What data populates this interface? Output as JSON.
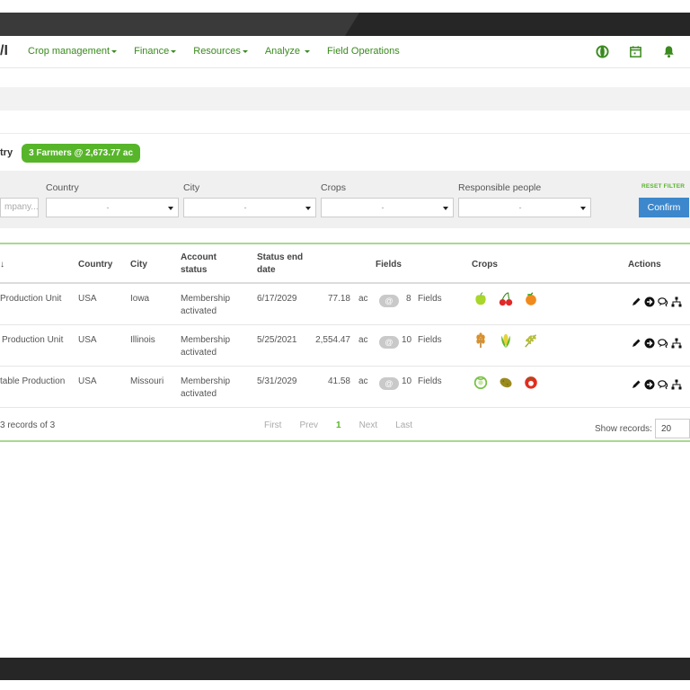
{
  "app": {
    "logo_text": "/I"
  },
  "nav": {
    "items": [
      {
        "label": "Crop management",
        "dropdown": true
      },
      {
        "label": "Finance",
        "dropdown": true
      },
      {
        "label": "Resources",
        "dropdown": true
      },
      {
        "label": "Analyze",
        "dropdown": true
      },
      {
        "label": "Field Operations",
        "dropdown": false
      }
    ],
    "icons": [
      "globe-icon",
      "calendar-icon",
      "bell-icon"
    ]
  },
  "summary": {
    "label": "try",
    "badge": "3 Farmers @ 2,673.77 ac"
  },
  "filters": {
    "company_placeholder": "mpany...",
    "country": {
      "label": "Country",
      "value": "-"
    },
    "city": {
      "label": "City",
      "value": "-"
    },
    "crops": {
      "label": "Crops",
      "value": "-"
    },
    "responsible": {
      "label": "Responsible people",
      "value": "-"
    },
    "reset_label": "RESET FILTER",
    "confirm_label": "Confirm"
  },
  "table": {
    "headers": {
      "first": "↓",
      "country": "Country",
      "city": "City",
      "account_status": "Account status",
      "status_end_date": "Status end date",
      "fields": "Fields",
      "crops": "Crops",
      "actions": "Actions"
    },
    "rows": [
      {
        "name": "Production Unit",
        "country": "USA",
        "city": "Iowa",
        "status": "Membership activated",
        "end_date": "6/17/2029",
        "area": "77.18",
        "unit": "ac",
        "at": "@",
        "fields_count": "8",
        "fields_label": "Fields",
        "crops": [
          "apple-icon",
          "cherry-icon",
          "orange-icon"
        ]
      },
      {
        "name": "Production Unit",
        "country": "USA",
        "city": "Illinois",
        "status": "Membership activated",
        "end_date": "5/25/2021",
        "area": "2,554.47",
        "unit": "ac",
        "at": "@",
        "fields_count": "10",
        "fields_label": "Fields",
        "crops": [
          "wheat-icon",
          "corn-icon",
          "barley-icon"
        ]
      },
      {
        "name": "table Production",
        "country": "USA",
        "city": "Missouri",
        "status": "Membership activated",
        "end_date": "5/31/2029",
        "area": "41.58",
        "unit": "ac",
        "at": "@",
        "fields_count": "10",
        "fields_label": "Fields",
        "crops": [
          "cabbage-icon",
          "potato-icon",
          "tomato-icon"
        ]
      }
    ]
  },
  "footer": {
    "records_text": "3 records of 3",
    "pager": {
      "first": "First",
      "prev": "Prev",
      "current": "1",
      "next": "Next",
      "last": "Last"
    },
    "show_records_label": "Show records:",
    "show_records_value": "20"
  },
  "colors": {
    "accent_green": "#57b52a",
    "nav_green": "#3a8a1e",
    "confirm_blue": "#3d87cc"
  }
}
